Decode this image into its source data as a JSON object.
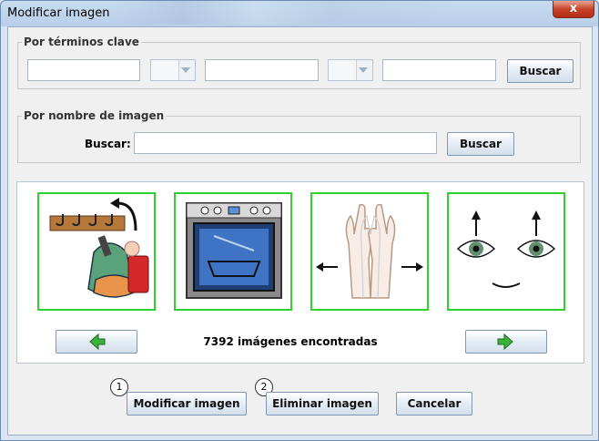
{
  "window": {
    "title": "Modificar imagen",
    "close_glyph": "x"
  },
  "keywords_group": {
    "legend": "Por términos clave",
    "field1_value": "",
    "field2_value": "",
    "field3_value": "",
    "search_label": "Buscar"
  },
  "name_group": {
    "legend": "Por nombre de imagen",
    "search_field_label": "Buscar:",
    "search_value": "",
    "search_label": "Buscar"
  },
  "results": {
    "thumbnails": [
      {
        "name": "coat-rack-backpack"
      },
      {
        "name": "oven"
      },
      {
        "name": "hands-sweep"
      },
      {
        "name": "eyes-raised"
      }
    ],
    "count_text": "7392 imágenes encontradas",
    "prev_icon": "green-left-arrow-icon",
    "next_icon": "green-right-arrow-icon"
  },
  "footer": {
    "badge1": "1",
    "badge2": "2",
    "modify_label": "Modificar imagen",
    "delete_label": "Eliminar imagen",
    "cancel_label": "Cancelar"
  },
  "colors": {
    "thumb_border": "#2fd02f",
    "arrow_green": "#3bb33b"
  }
}
